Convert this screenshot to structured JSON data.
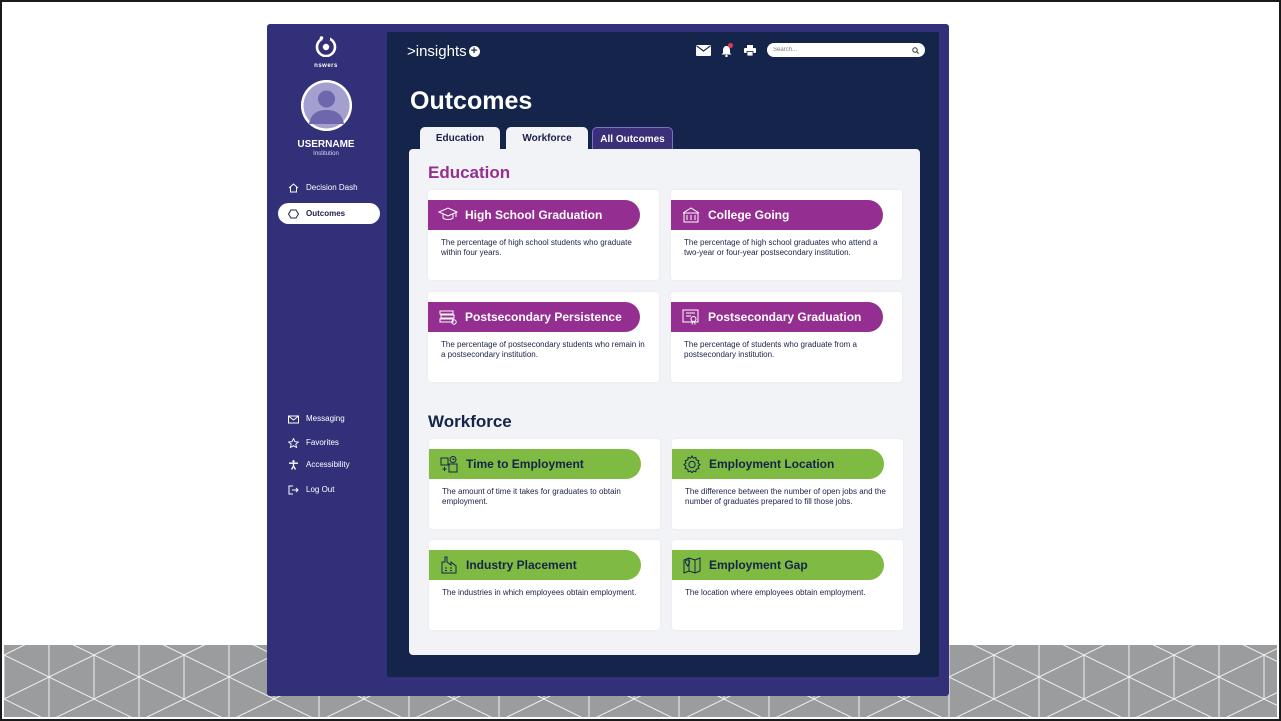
{
  "app": {
    "logo_text": "nswers",
    "brand": ">insights",
    "search_placeholder": "Search..."
  },
  "user": {
    "name": "USERNAME",
    "institution": "Institution"
  },
  "sidebar": {
    "items": [
      {
        "label": "Decision Dash",
        "icon": "home-icon",
        "active": false
      },
      {
        "label": "Outcomes",
        "icon": "hexagon-icon",
        "active": true
      }
    ],
    "bottom_items": [
      {
        "label": "Messaging",
        "icon": "envelope-icon"
      },
      {
        "label": "Favorites",
        "icon": "star-icon"
      },
      {
        "label": "Accessibility",
        "icon": "accessibility-icon"
      },
      {
        "label": "Log Out",
        "icon": "logout-icon"
      }
    ]
  },
  "page": {
    "title": "Outcomes",
    "tabs": [
      {
        "label": "Education"
      },
      {
        "label": "Workforce"
      },
      {
        "label": "All Outcomes"
      }
    ]
  },
  "education": {
    "title": "Education",
    "color": "#952e91",
    "cards": [
      {
        "title": "High School Graduation",
        "icon": "graduation-cap-icon",
        "desc": "The percentage of high school students who graduate within four years."
      },
      {
        "title": "College Going",
        "icon": "school-building-icon",
        "desc": "The percentage of high school graduates who attend a two-year or four-year postsecondary institution."
      },
      {
        "title": "Postsecondary Persistence",
        "icon": "book-stack-icon",
        "desc": "The percentage of postsecondary students who remain in a postsecondary institution."
      },
      {
        "title": "Postsecondary Graduation",
        "icon": "diploma-icon",
        "desc": "The percentage of students who graduate from a postsecondary institution."
      }
    ]
  },
  "workforce": {
    "title": "Workforce",
    "color": "#7fbb42",
    "cards": [
      {
        "title": "Time to Employment",
        "icon": "calendar-clock-icon",
        "desc": "The amount of time it takes for graduates to obtain employment."
      },
      {
        "title": "Employment Location",
        "icon": "gear-icon",
        "desc": "The difference between the number of open jobs and the number of graduates prepared to fill those jobs."
      },
      {
        "title": "Industry Placement",
        "icon": "factory-icon",
        "desc": "The industries in which employees obtain employment."
      },
      {
        "title": "Employment Gap",
        "icon": "map-pin-icon",
        "desc": "The location where employees obtain employment."
      }
    ]
  }
}
